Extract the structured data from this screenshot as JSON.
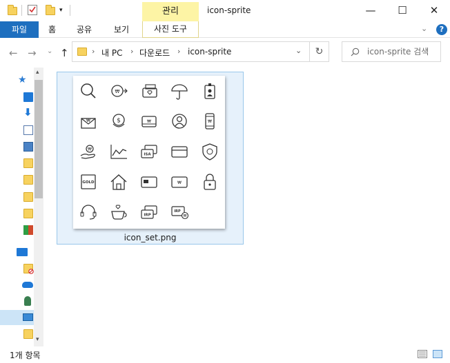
{
  "titlebar": {
    "manage_tab": "관리",
    "window_title": "icon-sprite",
    "minimize": "—",
    "maximize": "☐",
    "close": "✕"
  },
  "ribbon": {
    "tabs": [
      "파일",
      "홈",
      "공유",
      "보기"
    ],
    "picture_tools": "사진 도구"
  },
  "address": {
    "crumbs": [
      "내 PC",
      "다운로드",
      "icon-sprite"
    ],
    "search_placeholder": "icon-sprite 검색"
  },
  "files": [
    {
      "name": "icon_set.png"
    }
  ],
  "thumbnail_icons": [
    "search-icon",
    "won-coin-arrow-icon",
    "wallet-heart-icon",
    "umbrella-icon",
    "id-badge-icon",
    "envelope-won-icon",
    "dollar-coin-stack-icon",
    "wallet-won-icon",
    "user-circle-icon",
    "mobile-won-icon",
    "hand-won-icon",
    "line-chart-icon",
    "isa-cards-icon",
    "credit-card-icon",
    "shield-won-icon",
    "gold-bar-icon",
    "house-icon",
    "card-chip-icon",
    "card-won-icon",
    "lock-icon",
    "headset-icon",
    "coffee-heart-icon",
    "irp-cards-icon",
    "irp-won-card-icon"
  ],
  "status": {
    "item_count": "1개 항목"
  },
  "colors": {
    "accent": "#1e6fbf",
    "manage_tab_bg": "#fdf4a5",
    "selection_bg": "#e6f1fb",
    "selection_border": "#99c7ea",
    "folder": "#f7d25f"
  }
}
